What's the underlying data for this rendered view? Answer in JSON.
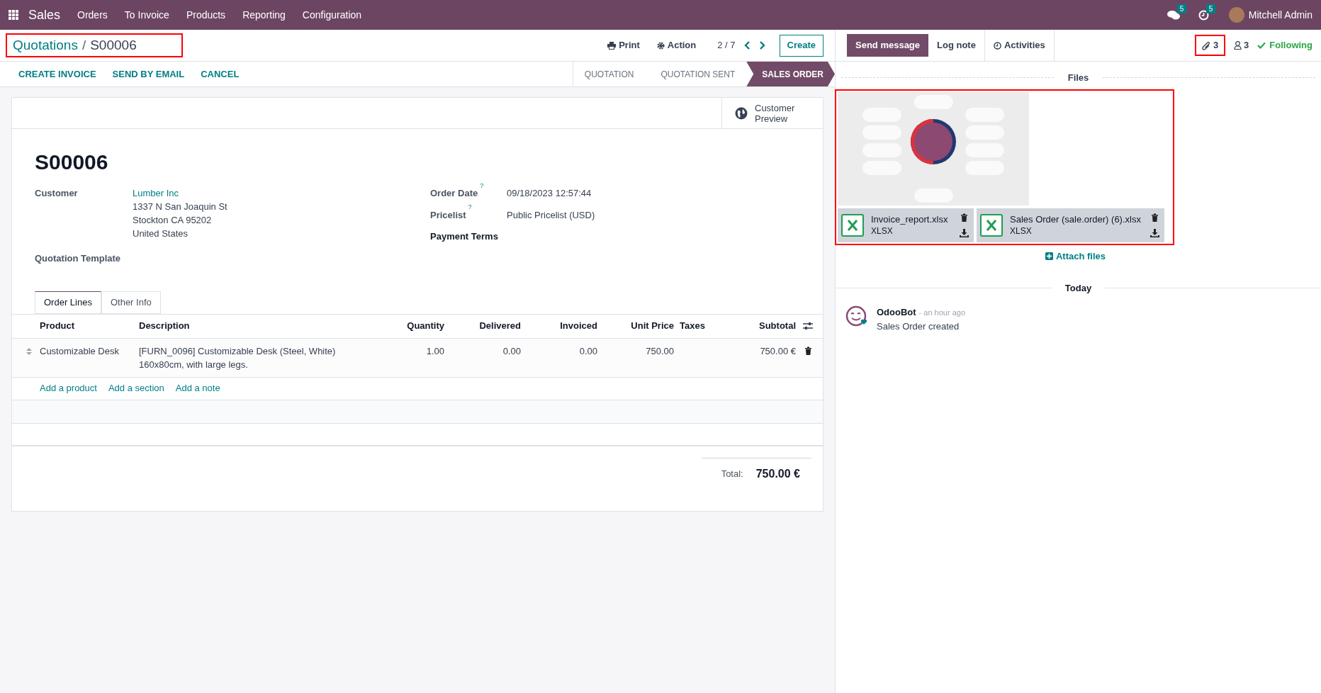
{
  "navbar": {
    "app": "Sales",
    "menu": [
      "Orders",
      "To Invoice",
      "Products",
      "Reporting",
      "Configuration"
    ],
    "messages_count": "5",
    "activities_count": "5",
    "user": "Mitchell Admin"
  },
  "breadcrumb": {
    "parent": "Quotations",
    "separator": "/",
    "current": "S00006"
  },
  "toolbar": {
    "print": "Print",
    "action": "Action",
    "pager": "2 / 7",
    "create": "Create"
  },
  "action_buttons": [
    "CREATE INVOICE",
    "SEND BY EMAIL",
    "CANCEL"
  ],
  "status_steps": [
    {
      "label": "QUOTATION",
      "selected": false
    },
    {
      "label": "QUOTATION SENT",
      "selected": false
    },
    {
      "label": "SALES ORDER",
      "selected": true
    }
  ],
  "smart_button": "Customer Preview",
  "record": {
    "name": "S00006",
    "customer": {
      "label": "Customer",
      "name": "Lumber Inc",
      "address": [
        "1337 N San Joaquin St",
        "Stockton CA 95202",
        "United States"
      ]
    },
    "quotation_template": "Quotation Template",
    "right_fields": [
      {
        "label": "Order Date",
        "help": "?",
        "value": "09/18/2023 12:57:44"
      },
      {
        "label": "Pricelist",
        "help": "?",
        "value": "Public Pricelist (USD)"
      },
      {
        "label": "Payment Terms"
      }
    ]
  },
  "tabs": [
    {
      "label": "Order Lines",
      "selected": true
    },
    {
      "label": "Other Info",
      "selected": false
    }
  ],
  "table": {
    "columns": [
      "Product",
      "Description",
      "Quantity",
      "Delivered",
      "Invoiced",
      "Unit Price",
      "Taxes",
      "Subtotal"
    ],
    "rows": [
      {
        "product": "Customizable Desk",
        "description": [
          "[FURN_0096] Customizable Desk (Steel, White)",
          "160x80cm, with large legs."
        ],
        "quantity": "1.00",
        "delivered": "0.00",
        "invoiced": "0.00",
        "unit_price": "750.00",
        "subtotal": "750.00 €"
      }
    ],
    "add_links": [
      "Add a product",
      "Add a section",
      "Add a note"
    ]
  },
  "total": {
    "label": "Total:",
    "value": "750.00 €"
  },
  "chatter": {
    "buttons": [
      {
        "label": "Send message",
        "selected": true
      },
      {
        "label": "Log note",
        "selected": false
      },
      {
        "label": "Activities",
        "selected": false
      }
    ],
    "attachments_count": "3",
    "followers_count": "3",
    "following": "Following",
    "files_title": "Files",
    "files": [
      {
        "kind": "picture"
      },
      {
        "kind": "file",
        "name": "Invoice_report.xlsx",
        "type": "XLSX"
      },
      {
        "kind": "file",
        "name": "Sales Order (sale.order) (6).xlsx",
        "type": "XLSX"
      }
    ],
    "attach": "Attach files",
    "day": "Today",
    "messages": [
      {
        "author": "OdooBot",
        "time": "- an hour ago",
        "body": "Sales Order created"
      }
    ]
  }
}
